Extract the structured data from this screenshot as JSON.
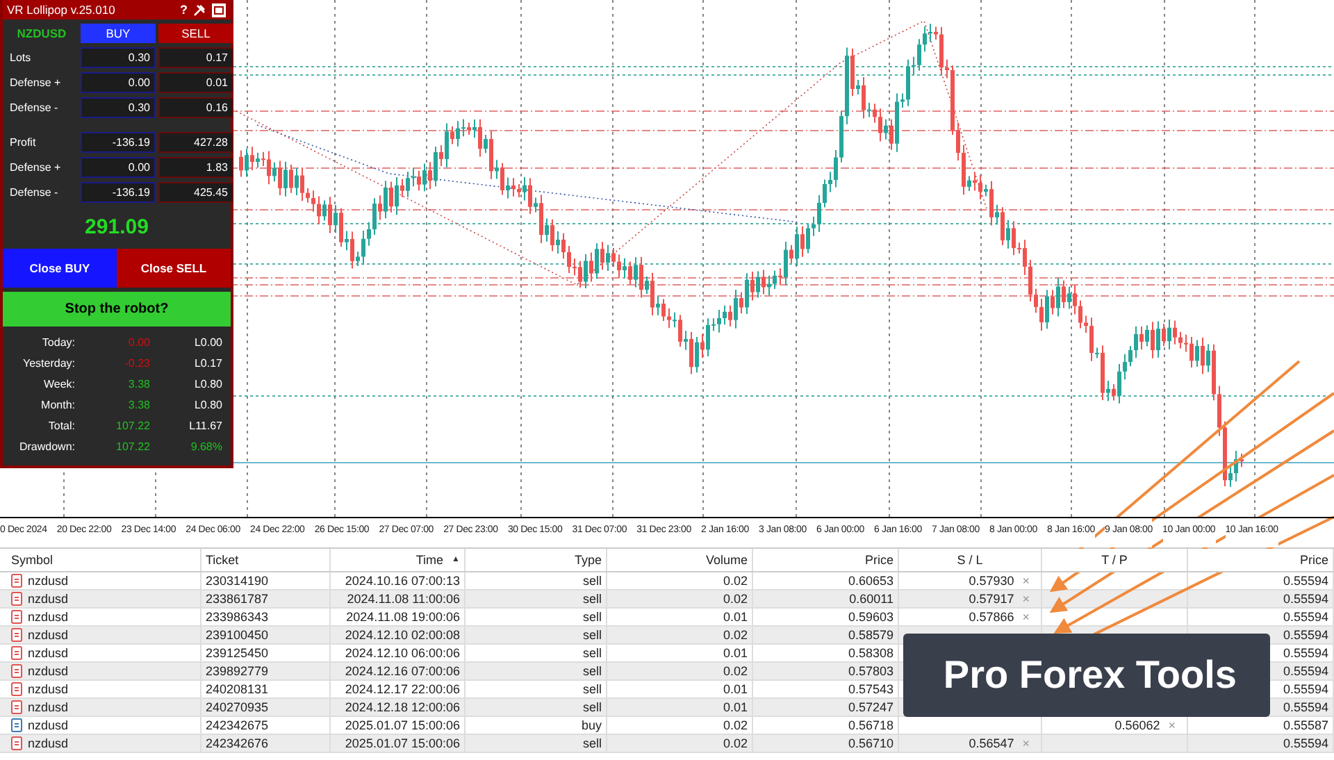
{
  "panel": {
    "title": "VR Lollipop v.25.010",
    "help": "?",
    "symbol": "NZDUSD",
    "buy_header": "BUY",
    "sell_header": "SELL",
    "positions": [
      {
        "label": "Lots",
        "buy": "0.30",
        "sell": "0.17"
      },
      {
        "label": "Defense +",
        "buy": "0.00",
        "sell": "0.01"
      },
      {
        "label": "Defense -",
        "buy": "0.30",
        "sell": "0.16"
      }
    ],
    "profits": [
      {
        "label": "Profit",
        "buy": "-136.19",
        "sell": "427.28"
      },
      {
        "label": "Defense +",
        "buy": "0.00",
        "sell": "1.83"
      },
      {
        "label": "Defense -",
        "buy": "-136.19",
        "sell": "425.45"
      }
    ],
    "total": "291.09",
    "close_buy": "Close BUY",
    "close_sell": "Close SELL",
    "stop": "Stop the robot?",
    "stats": [
      {
        "label": "Today:",
        "values": [
          {
            "text": "0.00",
            "color": "#d01010"
          },
          {
            "text": "L0.00",
            "color": "#ffffff"
          }
        ]
      },
      {
        "label": "Yesterday:",
        "values": [
          {
            "text": "-0.23",
            "color": "#d01010"
          },
          {
            "text": "L0.17",
            "color": "#ffffff"
          }
        ]
      },
      {
        "label": "Week:",
        "values": [
          {
            "text": "3.38",
            "color": "#22c022"
          },
          {
            "text": "L0.80",
            "color": "#ffffff"
          }
        ]
      },
      {
        "label": "Month:",
        "values": [
          {
            "text": "3.38",
            "color": "#22c022"
          },
          {
            "text": "L0.80",
            "color": "#ffffff"
          }
        ]
      },
      {
        "label": "Total:",
        "values": [
          {
            "text": "107.22",
            "color": "#22c022"
          },
          {
            "text": "L11.67",
            "color": "#ffffff"
          }
        ]
      },
      {
        "label": "Drawdown:",
        "values": [
          {
            "text": "107.22",
            "color": "#22c022"
          },
          {
            "text": "9.68%",
            "color": "#22c022"
          }
        ]
      }
    ]
  },
  "time_axis": [
    "0 Dec 2024",
    "20 Dec 22:00",
    "23 Dec 14:00",
    "24 Dec 06:00",
    "24 Dec 22:00",
    "26 Dec 15:00",
    "27 Dec 07:00",
    "27 Dec 23:00",
    "30 Dec 15:00",
    "31 Dec 07:00",
    "31 Dec 23:00",
    "2 Jan 16:00",
    "3 Jan 08:00",
    "6 Jan 00:00",
    "6 Jan 16:00",
    "7 Jan 08:00",
    "8 Jan 00:00",
    "8 Jan 16:00",
    "9 Jan 08:00",
    "10 Jan 00:00",
    "10 Jan 16:00"
  ],
  "table": {
    "columns": [
      {
        "label": "Symbol"
      },
      {
        "label": "Ticket"
      },
      {
        "label": "Time",
        "sort": "▲"
      },
      {
        "label": "Type"
      },
      {
        "label": "Volume"
      },
      {
        "label": "Price"
      },
      {
        "label": "S / L"
      },
      {
        "label": "T / P"
      },
      {
        "label": "Price"
      }
    ],
    "rows": [
      {
        "kind": "sell",
        "symbol": "nzdusd",
        "ticket": "230314190",
        "time": "2024.10.16 07:00:13",
        "type": "sell",
        "volume": "0.02",
        "price": "0.60653",
        "sl": "0.57930",
        "sl_remove": "×",
        "current": "0.55594"
      },
      {
        "kind": "sell",
        "symbol": "nzdusd",
        "ticket": "233861787",
        "time": "2024.11.08 11:00:06",
        "type": "sell",
        "volume": "0.02",
        "price": "0.60011",
        "sl": "0.57917",
        "sl_remove": "×",
        "current": "0.55594"
      },
      {
        "kind": "sell",
        "symbol": "nzdusd",
        "ticket": "233986343",
        "time": "2024.11.08 19:00:06",
        "type": "sell",
        "volume": "0.01",
        "price": "0.59603",
        "sl": "0.57866",
        "sl_remove": "×",
        "current": "0.55594"
      },
      {
        "kind": "sell",
        "symbol": "nzdusd",
        "ticket": "239100450",
        "time": "2024.12.10 02:00:08",
        "type": "sell",
        "volume": "0.02",
        "price": "0.58579",
        "current": "0.55594"
      },
      {
        "kind": "sell",
        "symbol": "nzdusd",
        "ticket": "239125450",
        "time": "2024.12.10 06:00:06",
        "type": "sell",
        "volume": "0.01",
        "price": "0.58308",
        "current": "0.55594"
      },
      {
        "kind": "sell",
        "symbol": "nzdusd",
        "ticket": "239892779",
        "time": "2024.12.16 07:00:06",
        "type": "sell",
        "volume": "0.02",
        "price": "0.57803",
        "current": "0.55594"
      },
      {
        "kind": "sell",
        "symbol": "nzdusd",
        "ticket": "240208131",
        "time": "2024.12.17 22:00:06",
        "type": "sell",
        "volume": "0.01",
        "price": "0.57543",
        "current": "0.55594"
      },
      {
        "kind": "sell",
        "symbol": "nzdusd",
        "ticket": "240270935",
        "time": "2024.12.18 12:00:06",
        "type": "sell",
        "volume": "0.01",
        "price": "0.57247",
        "current": "0.55594"
      },
      {
        "kind": "buy",
        "symbol": "nzdusd",
        "ticket": "242342675",
        "time": "2025.01.07 15:00:06",
        "type": "buy",
        "volume": "0.02",
        "price": "0.56718",
        "tp": "0.56062",
        "tp_remove": "×",
        "current": "0.55587"
      },
      {
        "kind": "sell",
        "symbol": "nzdusd",
        "ticket": "242342676",
        "time": "2025.01.07 15:00:06",
        "type": "sell",
        "volume": "0.02",
        "price": "0.56710",
        "sl": "0.56547",
        "sl_remove": "×",
        "current": "0.55594"
      }
    ]
  },
  "banner": "Pro Forex Tools"
}
